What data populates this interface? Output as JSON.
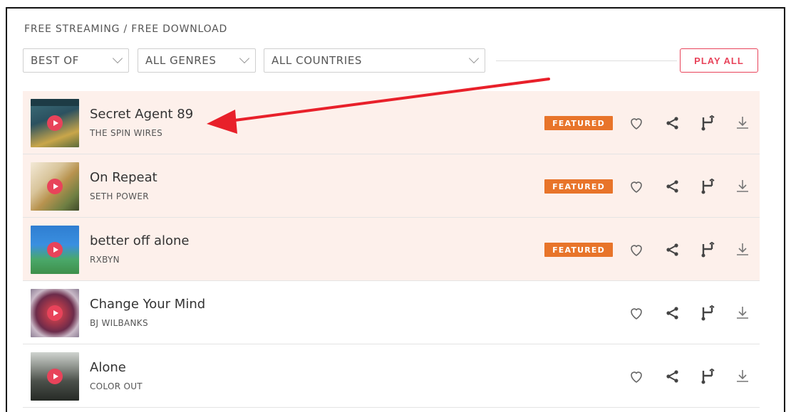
{
  "heading": "FREE STREAMING / FREE DOWNLOAD",
  "filters": {
    "sort": "BEST OF",
    "genre": "ALL GENRES",
    "country": "ALL COUNTRIES",
    "play_all": "PLAY ALL"
  },
  "tracks": [
    {
      "title": "Secret Agent 89",
      "artist": "THE SPIN WIRES",
      "badge": "FEATURED",
      "featured": true
    },
    {
      "title": "On Repeat",
      "artist": "SETH POWER",
      "badge": "FEATURED",
      "featured": true
    },
    {
      "title": "better off alone",
      "artist": "RXBYN",
      "badge": "FEATURED",
      "featured": true
    },
    {
      "title": "Change Your Mind",
      "artist": "BJ WILBANKS",
      "featured": false
    },
    {
      "title": "Alone",
      "artist": "COLOR OUT",
      "featured": false
    }
  ],
  "colors": {
    "accent": "#e8435a",
    "featured_badge": "#e8742a",
    "featured_row": "#fdf0eb",
    "annotation_arrow": "#e8202a"
  },
  "icons": [
    "play-icon",
    "heart-icon",
    "share-icon",
    "remix-icon",
    "download-icon",
    "chevron-down-icon",
    "arrow-annotation"
  ]
}
